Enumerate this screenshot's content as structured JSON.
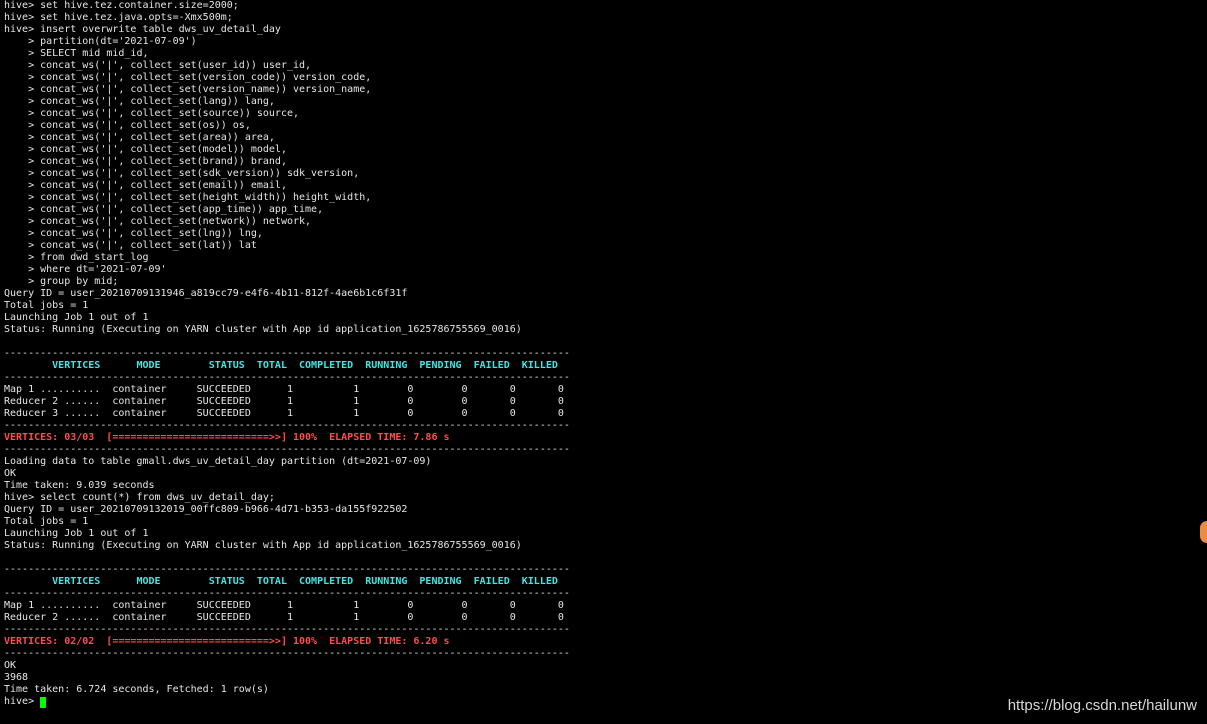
{
  "terminal": {
    "lines": [
      {
        "text": "hive> set hive.tez.container.size=2000;",
        "style": "normal"
      },
      {
        "text": "hive> set hive.tez.java.opts=-Xmx500m;",
        "style": "normal"
      },
      {
        "text": "hive> insert overwrite table dws_uv_detail_day",
        "style": "normal"
      },
      {
        "text": "    > partition(dt='2021-07-09')",
        "style": "normal"
      },
      {
        "text": "    > SELECT mid mid_id,",
        "style": "normal"
      },
      {
        "text": "    > concat_ws('|', collect_set(user_id)) user_id,",
        "style": "normal"
      },
      {
        "text": "    > concat_ws('|', collect_set(version_code)) version_code,",
        "style": "normal"
      },
      {
        "text": "    > concat_ws('|', collect_set(version_name)) version_name,",
        "style": "normal"
      },
      {
        "text": "    > concat_ws('|', collect_set(lang)) lang,",
        "style": "normal"
      },
      {
        "text": "    > concat_ws('|', collect_set(source)) source,",
        "style": "normal"
      },
      {
        "text": "    > concat_ws('|', collect_set(os)) os,",
        "style": "normal"
      },
      {
        "text": "    > concat_ws('|', collect_set(area)) area,",
        "style": "normal"
      },
      {
        "text": "    > concat_ws('|', collect_set(model)) model,",
        "style": "normal"
      },
      {
        "text": "    > concat_ws('|', collect_set(brand)) brand,",
        "style": "normal"
      },
      {
        "text": "    > concat_ws('|', collect_set(sdk_version)) sdk_version,",
        "style": "normal"
      },
      {
        "text": "    > concat_ws('|', collect_set(email)) email,",
        "style": "normal"
      },
      {
        "text": "    > concat_ws('|', collect_set(height_width)) height_width,",
        "style": "normal"
      },
      {
        "text": "    > concat_ws('|', collect_set(app_time)) app_time,",
        "style": "normal"
      },
      {
        "text": "    > concat_ws('|', collect_set(network)) network,",
        "style": "normal"
      },
      {
        "text": "    > concat_ws('|', collect_set(lng)) lng,",
        "style": "normal"
      },
      {
        "text": "    > concat_ws('|', collect_set(lat)) lat",
        "style": "normal"
      },
      {
        "text": "    > from dwd_start_log",
        "style": "normal"
      },
      {
        "text": "    > where dt='2021-07-09'",
        "style": "normal"
      },
      {
        "text": "    > group by mid;",
        "style": "normal"
      },
      {
        "text": "Query ID = user_20210709131946_a819cc79-e4f6-4b11-812f-4ae6b1c6f31f",
        "style": "normal"
      },
      {
        "text": "Total jobs = 1",
        "style": "normal"
      },
      {
        "text": "Launching Job 1 out of 1",
        "style": "normal"
      },
      {
        "text": "Status: Running (Executing on YARN cluster with App id application_1625786755569_0016)",
        "style": "normal"
      },
      {
        "text": "",
        "style": "normal"
      },
      {
        "text": "----------------------------------------------------------------------------------------------",
        "style": "normal"
      },
      {
        "text": "        VERTICES      MODE        STATUS  TOTAL  COMPLETED  RUNNING  PENDING  FAILED  KILLED",
        "style": "cyan"
      },
      {
        "text": "----------------------------------------------------------------------------------------------",
        "style": "normal"
      },
      {
        "text": "Map 1 ..........  container     SUCCEEDED      1          1        0        0       0       0",
        "style": "normal"
      },
      {
        "text": "Reducer 2 ......  container     SUCCEEDED      1          1        0        0       0       0",
        "style": "normal"
      },
      {
        "text": "Reducer 3 ......  container     SUCCEEDED      1          1        0        0       0       0",
        "style": "normal"
      },
      {
        "text": "----------------------------------------------------------------------------------------------",
        "style": "normal"
      },
      {
        "text": "VERTICES: 03/03  [==========================>>] 100%  ELAPSED TIME: 7.86 s",
        "style": "red"
      },
      {
        "text": "----------------------------------------------------------------------------------------------",
        "style": "normal"
      },
      {
        "text": "Loading data to table gmall.dws_uv_detail_day partition (dt=2021-07-09)",
        "style": "normal"
      },
      {
        "text": "OK",
        "style": "normal"
      },
      {
        "text": "Time taken: 9.039 seconds",
        "style": "normal"
      },
      {
        "text": "hive> select count(*) from dws_uv_detail_day;",
        "style": "normal"
      },
      {
        "text": "Query ID = user_20210709132019_00ffc809-b966-4d71-b353-da155f922502",
        "style": "normal"
      },
      {
        "text": "Total jobs = 1",
        "style": "normal"
      },
      {
        "text": "Launching Job 1 out of 1",
        "style": "normal"
      },
      {
        "text": "Status: Running (Executing on YARN cluster with App id application_1625786755569_0016)",
        "style": "normal"
      },
      {
        "text": "",
        "style": "normal"
      },
      {
        "text": "----------------------------------------------------------------------------------------------",
        "style": "normal"
      },
      {
        "text": "        VERTICES      MODE        STATUS  TOTAL  COMPLETED  RUNNING  PENDING  FAILED  KILLED",
        "style": "cyan"
      },
      {
        "text": "----------------------------------------------------------------------------------------------",
        "style": "normal"
      },
      {
        "text": "Map 1 ..........  container     SUCCEEDED      1          1        0        0       0       0",
        "style": "normal"
      },
      {
        "text": "Reducer 2 ......  container     SUCCEEDED      1          1        0        0       0       0",
        "style": "normal"
      },
      {
        "text": "----------------------------------------------------------------------------------------------",
        "style": "normal"
      },
      {
        "text": "VERTICES: 02/02  [==========================>>] 100%  ELAPSED TIME: 6.20 s",
        "style": "red"
      },
      {
        "text": "----------------------------------------------------------------------------------------------",
        "style": "normal"
      },
      {
        "text": "OK",
        "style": "normal"
      },
      {
        "text": "3968",
        "style": "normal"
      },
      {
        "text": "Time taken: 6.724 seconds, Fetched: 1 row(s)",
        "style": "normal"
      }
    ],
    "prompt": "hive> "
  },
  "watermark": {
    "text": "https://blog.csdn.net/hailunw"
  },
  "colors": {
    "background": "#000000",
    "text": "#e6e6e6",
    "header": "#44e4e4",
    "progress": "#ff4c4c",
    "cursor": "#00ff00"
  }
}
